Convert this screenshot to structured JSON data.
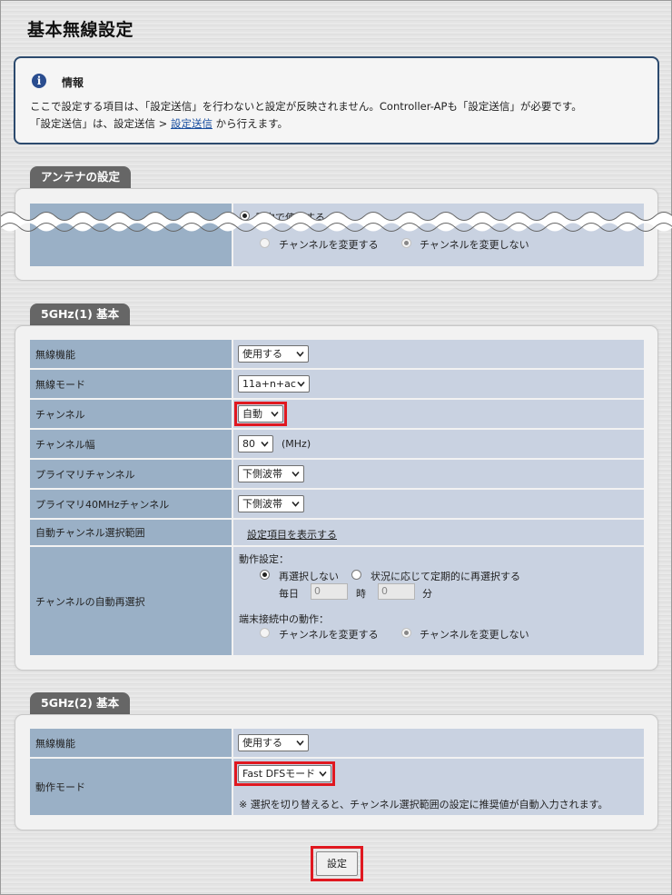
{
  "page": {
    "title": "基本無線設定"
  },
  "info": {
    "title": "情報",
    "line1": "ここで設定する項目は、「設定送信」を行わないと設定が反映されません。Controller-APも「設定送信」が必要です。",
    "line2_prefix": "「設定送信」は、設定送信 > ",
    "line2_link": "設定送信",
    "line2_suffix": " から行えます。"
  },
  "antenna": {
    "tab": "アンテナの設定",
    "indoor_label": "屋内で使用する",
    "opt_change": "チャンネルを変更する",
    "opt_nochange": "チャンネルを変更しない"
  },
  "band1": {
    "tab": "5GHz(1) 基本",
    "rows": {
      "wireless_function": {
        "label": "無線機能",
        "value": "使用する"
      },
      "wireless_mode": {
        "label": "無線モード",
        "value": "11a+n+ac"
      },
      "channel": {
        "label": "チャンネル",
        "value": "自動"
      },
      "channel_width": {
        "label": "チャンネル幅",
        "value": "80",
        "unit": "(MHz)"
      },
      "primary_channel": {
        "label": "プライマリチャンネル",
        "value": "下側波帯"
      },
      "primary_40": {
        "label": "プライマリ40MHzチャンネル",
        "value": "下側波帯"
      },
      "auto_range": {
        "label": "自動チャンネル選択範囲",
        "link": "設定項目を表示する"
      },
      "auto_reselect": {
        "label": "チャンネルの自動再選択",
        "op_title": "動作設定：",
        "opt_no": "再選択しない",
        "opt_periodic": "状況に応じて定期的に再選択する",
        "daily": "毎日",
        "hour_value": "0",
        "hour_unit": "時",
        "min_value": "0",
        "min_unit": "分",
        "conn_title": "端末接続中の動作：",
        "opt_change": "チャンネルを変更する",
        "opt_nochange": "チャンネルを変更しない"
      }
    }
  },
  "band2": {
    "tab": "5GHz(2) 基本",
    "rows": {
      "wireless_function": {
        "label": "無線機能",
        "value": "使用する"
      },
      "operation_mode": {
        "label": "動作モード",
        "value": "Fast DFSモード",
        "note": "※ 選択を切り替えると、チャンネル選択範囲の設定に推奨値が自動入力されます。"
      }
    }
  },
  "actions": {
    "set_label": "設定"
  },
  "colors": {
    "label_bg": "#9ab0c6",
    "value_bg": "#c9d2e1",
    "highlight": "#e01820",
    "tab_bg": "#666666",
    "info_border": "#2c4a6e"
  }
}
